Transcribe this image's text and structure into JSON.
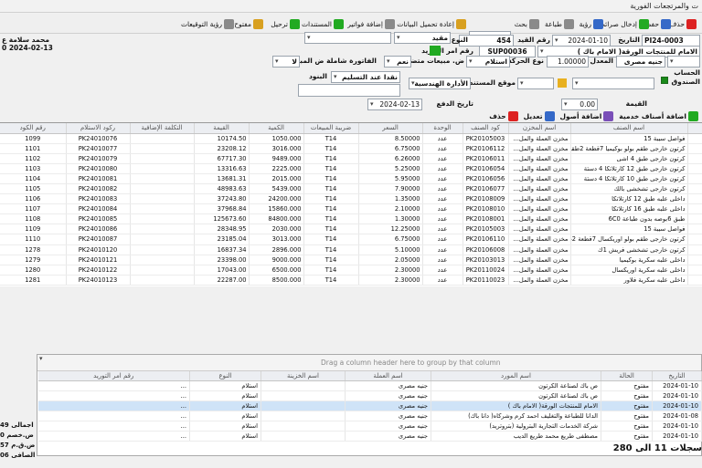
{
  "window": {
    "title": "ت والمرتجعات الفورية"
  },
  "toolbar": {
    "delete": "حذف",
    "save": "حفظ",
    "print_receipt": "إدخال صرائب",
    "view": "رؤية",
    "print": "طباعة",
    "search": "بحث",
    "reload": "إعادة تحميل البيانات",
    "add_invoices": "إضافة فواتير",
    "documents": "المستندات",
    "transfer": "ترحيل",
    "open": "مفتوح",
    "view_signatures": "رؤية التوقيعات",
    "search_value": ""
  },
  "header": {
    "doc_no": "PI24-0003",
    "date_label": "التاريخ",
    "date": "2024-01-10",
    "ref_label": "رقم القيد",
    "ref_no": "454",
    "type_label": "النوع",
    "type_value": "مقيد",
    "supplier_name": "الامام للمنتجات الورقة( الامام باك )",
    "supplier_code": "SUP00036",
    "order_label": "رقم امر التوريد",
    "currency": "جنيه مصرى",
    "rate_label": "المعدل",
    "rate": "1.00000",
    "move_type_label": "نوع الحركة",
    "move_type": "استلام",
    "sales_label": "ض. مبيعات متضمنة",
    "sales_value": "نعم",
    "invoice_incl_label": "الفاتورة شاملة ض المبيعات",
    "invoice_incl_value": "لا",
    "account_label": "الحساب",
    "cashbox_label": "الصندوق",
    "doc_location_label": "موقع المستندات",
    "doc_location": "الأدارة الهندسية",
    "items_label": "البنود",
    "items_value": "نقدا عند التسليم",
    "value_label": "القيمة",
    "value": "0.00",
    "pay_date_label": "تاريخ الدفع",
    "pay_date": "2024-02-13",
    "left_name": "محمد سلامة ع",
    "left_date": "2024-02-13 0"
  },
  "actions": {
    "add_service": "اضافة أصناف خدمية",
    "add_item": "اضافة أصول",
    "edit": "تعديل",
    "delete": "حذف"
  },
  "grid1": {
    "columns": [
      "",
      "اسم الصنف",
      "اسم المخزن",
      "كود الصنف",
      "الوحدة",
      "السعر",
      "ضريبة المبيعات",
      "الكمية",
      "القيمة",
      "التكلفة الإضافية",
      "ركود الاستلام",
      "رقم الكود"
    ],
    "rows": [
      {
        "name": "فواصل سيبة 15",
        "store": "مخزن العملة والمل...",
        "code": "PK20105003",
        "unit": "عدد",
        "price": "8.50000",
        "tax": "T14",
        "qty": "1050.000",
        "value": "10174.50",
        "extra": "",
        "receipt": "PK24010076",
        "no": "1099"
      },
      {
        "name": "كرتون خارجى طقم بولو بوكيميا 7قطعة 2طقم",
        "store": "مخزن العملة والمل...",
        "code": "PK20106112",
        "unit": "عدد",
        "price": "6.75000",
        "tax": "T14",
        "qty": "3016.000",
        "value": "23208.12",
        "extra": "",
        "receipt": "PK24010077",
        "no": "1101"
      },
      {
        "name": "كرتون خارجى طبق 4 اشى",
        "store": "مخزن العملة والمل...",
        "code": "PK20106011",
        "unit": "عدد",
        "price": "6.26000",
        "tax": "T14",
        "qty": "9489.000",
        "value": "67717.30",
        "extra": "",
        "receipt": "PK24010079",
        "no": "1102"
      },
      {
        "name": "كرتون خارجى طبق 12 كارتلاتكا 4 دستة",
        "store": "مخزن العملة والمل...",
        "code": "PK20106054",
        "unit": "عدد",
        "price": "5.25000",
        "tax": "T14",
        "qty": "2225.000",
        "value": "13316.63",
        "extra": "",
        "receipt": "PK24010080",
        "no": "1103"
      },
      {
        "name": "كرتون خارجى طبق 10 كارتلاتكا 4 دستة",
        "store": "مخزن العملة والمل...",
        "code": "PK20106056",
        "unit": "عدد",
        "price": "5.95000",
        "tax": "T14",
        "qty": "2015.000",
        "value": "13681.31",
        "extra": "",
        "receipt": "PK24010081",
        "no": "1104"
      },
      {
        "name": "كرتون خارجى تشخشى بالك",
        "store": "مخزن العملة والمل...",
        "code": "PK20106077",
        "unit": "عدد",
        "price": "7.90000",
        "tax": "T14",
        "qty": "5439.000",
        "value": "48983.63",
        "extra": "",
        "receipt": "PK24010082",
        "no": "1105"
      },
      {
        "name": "داخلى علبه طبق 12 كارتلاتكا",
        "store": "مخزن العملة والمل...",
        "code": "PK20108009",
        "unit": "عدد",
        "price": "1.35000",
        "tax": "T14",
        "qty": "24200.000",
        "value": "37243.80",
        "extra": "",
        "receipt": "PK24010083",
        "no": "1106"
      },
      {
        "name": "داخلى علبه طبق 16 كارتلاتكا",
        "store": "مخزن العملة والمل...",
        "code": "PK20108010",
        "unit": "عدد",
        "price": "2.10000",
        "tax": "T14",
        "qty": "15860.000",
        "value": "37968.84",
        "extra": "",
        "receipt": "PK24010084",
        "no": "1107"
      },
      {
        "name": "طبق 6بوصه بدون طباعة 6C0",
        "store": "مخزن العملة والمل...",
        "code": "PK20108001",
        "unit": "عدد",
        "price": "1.30000",
        "tax": "T14",
        "qty": "84800.000",
        "value": "125673.60",
        "extra": "",
        "receipt": "PK24010085",
        "no": "1108"
      },
      {
        "name": "فواصل سيبة 15",
        "store": "مخزن العملة والمل...",
        "code": "PK20105003",
        "unit": "عدد",
        "price": "12.25000",
        "tax": "T14",
        "qty": "2030.000",
        "value": "28348.95",
        "extra": "",
        "receipt": "PK24010086",
        "no": "1109"
      },
      {
        "name": "كرتون خارجى طقم بولو اوريكسال 7قطعة 2طقم",
        "store": "مخزن العملة والمل...",
        "code": "PK20106110",
        "unit": "عدد",
        "price": "6.75000",
        "tax": "T14",
        "qty": "3013.000",
        "value": "23185.04",
        "extra": "",
        "receipt": "PK24010087",
        "no": "1110"
      },
      {
        "name": "كرتون خارجى تشخشى فريش 1ك",
        "store": "مخزن العملة والمل...",
        "code": "PK20106008",
        "unit": "عدد",
        "price": "5.10000",
        "tax": "T14",
        "qty": "2896.000",
        "value": "16837.34",
        "extra": "",
        "receipt": "PK24010120",
        "no": "1278"
      },
      {
        "name": "داخلى علبه سكرية بوكيميا",
        "store": "مخزن العملة والمل...",
        "code": "PK20103013",
        "unit": "عدد",
        "price": "2.05000",
        "tax": "T14",
        "qty": "9000.000",
        "value": "23398.00",
        "extra": "",
        "receipt": "PK24010121",
        "no": "1279"
      },
      {
        "name": "داخلى علبه سكرية اوريكسال",
        "store": "مخزن العملة والمل...",
        "code": "PK20110024",
        "unit": "عدد",
        "price": "2.30000",
        "tax": "T14",
        "qty": "6500.000",
        "value": "17043.00",
        "extra": "",
        "receipt": "PK24010122",
        "no": "1280"
      },
      {
        "name": "داخلى علبه سكرية فلاور",
        "store": "مخزن العملة والمل...",
        "code": "PK20110023",
        "unit": "عدد",
        "price": "2.30000",
        "tax": "T14",
        "qty": "8500.000",
        "value": "22287.00",
        "extra": "",
        "receipt": "PK24010123",
        "no": "1281"
      }
    ]
  },
  "grid2": {
    "group_hint": "Drag a column header here to group by that column",
    "columns": [
      "التاريخ",
      "الحالة",
      "اسم المورد",
      "اسم العملة",
      "اسم الخزينة",
      "النوع",
      "رقم امر التوريد"
    ],
    "rows": [
      {
        "date": "2024-01-10",
        "status": "مفتوح",
        "supplier": "ص باك لصناعة الكرتون",
        "currency": "جنيه مصرى",
        "box": "",
        "type": "استلام",
        "order": "..."
      },
      {
        "date": "2024-01-10",
        "status": "مفتوح",
        "supplier": "ص باك لصناعة الكرتون",
        "currency": "جنيه مصرى",
        "box": "",
        "type": "استلام",
        "order": "..."
      },
      {
        "date": "2024-01-10",
        "status": "مفتوح",
        "supplier": "الامام للمنتجات الورقة( الامام باك )",
        "currency": "جنيه مصرى",
        "box": "",
        "type": "استلام",
        "order": "..."
      },
      {
        "date": "2024-01-08",
        "status": "مفتوح",
        "supplier": "الدانا للطباعة والتغليف احمد كرم وشركاه( دانا باك)",
        "currency": "جنيه مصرى",
        "box": "",
        "type": "استلام",
        "order": "..."
      },
      {
        "date": "2024-01-10",
        "status": "مفتوح",
        "supplier": "شركة الخدمات التجارية البترولية (بتروتريد)",
        "currency": "جنيه مصرى",
        "box": "",
        "type": "استلام",
        "order": "..."
      },
      {
        "date": "2024-01-10",
        "status": "مفتوح",
        "supplier": "مصطفى طريع محمد طريع الديب",
        "currency": "جنيه مصرى",
        "box": "",
        "type": "استلام",
        "order": "..."
      }
    ],
    "status": "سجلات 11 الى 280"
  },
  "totals": {
    "total_label": "اجمالى",
    "total": "49",
    "disc_label": "ض.خصم",
    "disc": "0",
    "tax_label": "ض.ق.م",
    "tax": "57",
    "net_label": "الصافى",
    "net": "06"
  }
}
